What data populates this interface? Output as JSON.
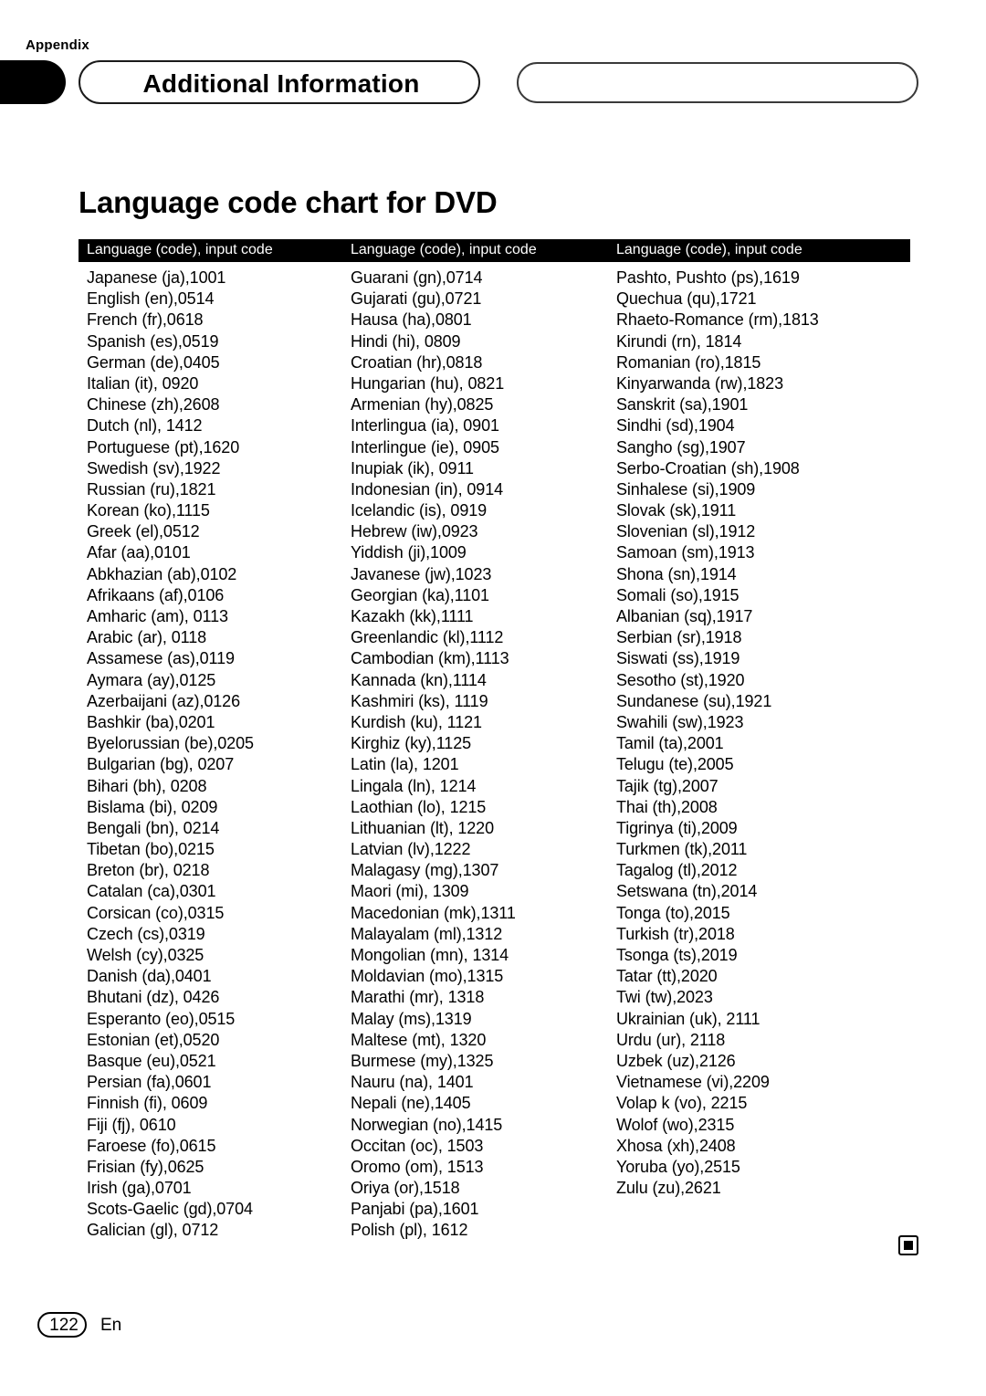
{
  "header": {
    "appendix_label": "Appendix",
    "title": "Additional Information",
    "empty_pill": ""
  },
  "section": {
    "title": "Language code chart for DVD"
  },
  "table": {
    "column_headers": [
      "Language (code), input code",
      "Language (code), input code",
      "Language (code), input code"
    ],
    "columns": [
      [
        "Japanese (ja),1001",
        "English (en),0514",
        "French (fr),0618",
        "Spanish (es),0519",
        "German (de),0405",
        "Italian (it), 0920",
        "Chinese (zh),2608",
        "Dutch (nl), 1412",
        "Portuguese (pt),1620",
        "Swedish (sv),1922",
        "Russian (ru),1821",
        "Korean (ko),1115",
        "Greek (el),0512",
        "Afar (aa),0101",
        "Abkhazian (ab),0102",
        "Afrikaans (af),0106",
        "Amharic (am), 0113",
        "Arabic (ar), 0118",
        "Assamese (as),0119",
        "Aymara (ay),0125",
        "Azerbaijani (az),0126",
        "Bashkir (ba),0201",
        "Byelorussian (be),0205",
        "Bulgarian (bg), 0207",
        "Bihari (bh), 0208",
        "Bislama (bi), 0209",
        "Bengali (bn), 0214",
        "Tibetan (bo),0215",
        "Breton (br), 0218",
        "Catalan (ca),0301",
        "Corsican (co),0315",
        "Czech (cs),0319",
        "Welsh (cy),0325",
        "Danish (da),0401",
        "Bhutani (dz), 0426",
        "Esperanto (eo),0515",
        "Estonian (et),0520",
        "Basque (eu),0521",
        "Persian (fa),0601",
        "Finnish (fi), 0609",
        "Fiji (fj), 0610",
        "Faroese (fo),0615",
        "Frisian (fy),0625",
        "Irish (ga),0701",
        "Scots-Gaelic (gd),0704",
        "Galician (gl), 0712"
      ],
      [
        "Guarani (gn),0714",
        "Gujarati (gu),0721",
        "Hausa (ha),0801",
        "Hindi (hi), 0809",
        "Croatian (hr),0818",
        "Hungarian (hu), 0821",
        "Armenian (hy),0825",
        "Interlingua (ia), 0901",
        "Interlingue (ie), 0905",
        "Inupiak (ik), 0911",
        "Indonesian (in), 0914",
        "Icelandic (is), 0919",
        "Hebrew (iw),0923",
        "Yiddish (ji),1009",
        "Javanese (jw),1023",
        "Georgian (ka),1101",
        "Kazakh (kk),1111",
        "Greenlandic (kl),1112",
        "Cambodian (km),1113",
        "Kannada (kn),1114",
        "Kashmiri (ks), 1119",
        "Kurdish (ku), 1121",
        "Kirghiz (ky),1125",
        "Latin (la), 1201",
        "Lingala (ln), 1214",
        "Laothian (lo), 1215",
        "Lithuanian (lt), 1220",
        "Latvian (lv),1222",
        "Malagasy (mg),1307",
        "Maori (mi), 1309",
        "Macedonian (mk),1311",
        "Malayalam (ml),1312",
        "Mongolian (mn), 1314",
        "Moldavian (mo),1315",
        "Marathi (mr), 1318",
        "Malay (ms),1319",
        "Maltese (mt), 1320",
        "Burmese (my),1325",
        "Nauru (na), 1401",
        "Nepali (ne),1405",
        "Norwegian (no),1415",
        "Occitan (oc), 1503",
        "Oromo (om), 1513",
        "Oriya (or),1518",
        "Panjabi (pa),1601",
        "Polish (pl), 1612"
      ],
      [
        "Pashto, Pushto (ps),1619",
        "Quechua (qu),1721",
        "Rhaeto-Romance (rm),1813",
        "Kirundi (rn), 1814",
        "Romanian (ro),1815",
        "Kinyarwanda (rw),1823",
        "Sanskrit (sa),1901",
        "Sindhi (sd),1904",
        "Sangho (sg),1907",
        "Serbo-Croatian (sh),1908",
        "Sinhalese (si),1909",
        "Slovak (sk),1911",
        "Slovenian (sl),1912",
        "Samoan (sm),1913",
        "Shona (sn),1914",
        "Somali (so),1915",
        "Albanian (sq),1917",
        "Serbian (sr),1918",
        "Siswati (ss),1919",
        "Sesotho (st),1920",
        "Sundanese (su),1921",
        "Swahili (sw),1923",
        "Tamil (ta),2001",
        "Telugu (te),2005",
        "Tajik (tg),2007",
        "Thai (th),2008",
        "Tigrinya (ti),2009",
        "Turkmen (tk),2011",
        "Tagalog (tl),2012",
        "Setswana (tn),2014",
        "Tonga (to),2015",
        "Turkish (tr),2018",
        "Tsonga (ts),2019",
        "Tatar (tt),2020",
        "Twi (tw),2023",
        "Ukrainian (uk), 2111",
        "Urdu (ur), 2118",
        "Uzbek (uz),2126",
        "Vietnamese (vi),2209",
        "Volap k (vo), 2215",
        "Wolof (wo),2315",
        "Xhosa (xh),2408",
        "Yoruba (yo),2515",
        "Zulu (zu),2621"
      ]
    ]
  },
  "footer": {
    "page_number": "122",
    "language_code": "En"
  },
  "colors": {
    "text": "#000000",
    "header_bar": "#000000",
    "header_bar_text": "#ffffff",
    "background": "#ffffff"
  }
}
